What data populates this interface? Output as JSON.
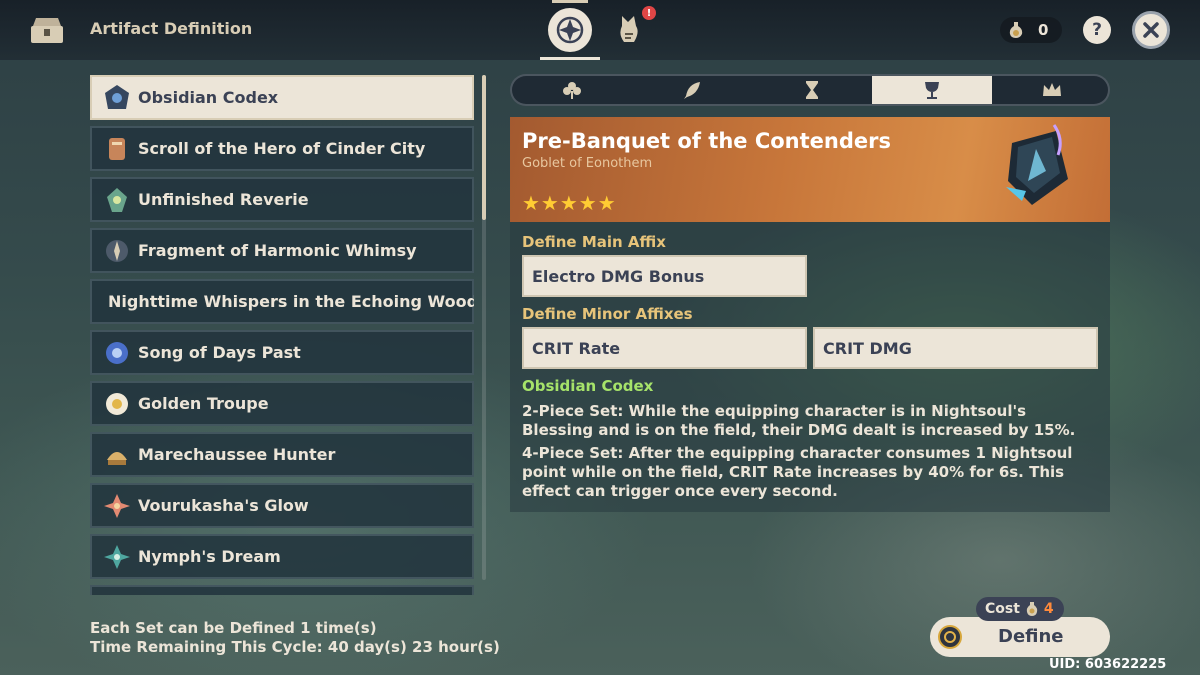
{
  "header": {
    "title": "Artifact Definition",
    "notification_badge": "!",
    "currency_count": "0",
    "help_label": "?"
  },
  "sets": [
    {
      "label": "Obsidian Codex",
      "selected": true,
      "icon": "obsidian-codex-icon"
    },
    {
      "label": "Scroll of the Hero of Cinder City",
      "icon": "scroll-hero-icon"
    },
    {
      "label": "Unfinished Reverie",
      "icon": "unfinished-reverie-icon"
    },
    {
      "label": "Fragment of Harmonic Whimsy",
      "icon": "harmonic-whimsy-icon"
    },
    {
      "label": "Nighttime Whispers in the Echoing Woods",
      "icon": "nighttime-whispers-icon"
    },
    {
      "label": "Song of Days Past",
      "icon": "song-days-past-icon"
    },
    {
      "label": "Golden Troupe",
      "icon": "golden-troupe-icon"
    },
    {
      "label": "Marechaussee Hunter",
      "icon": "marechaussee-hunter-icon"
    },
    {
      "label": "Vourukasha's Glow",
      "icon": "vourukasha-glow-icon"
    },
    {
      "label": "Nymph's Dream",
      "icon": "nymphs-dream-icon"
    }
  ],
  "footer": {
    "line1": "Each Set can be Defined 1 time(s)",
    "line2": "Time Remaining This Cycle: 40 day(s) 23 hour(s)"
  },
  "slot_tabs": [
    {
      "icon": "flower-icon"
    },
    {
      "icon": "feather-icon"
    },
    {
      "icon": "hourglass-icon"
    },
    {
      "icon": "goblet-icon",
      "active": true
    },
    {
      "icon": "crown-icon"
    }
  ],
  "artifact": {
    "name": "Pre-Banquet of the Contenders",
    "type": "Goblet of Eonothem",
    "stars": "★★★★★",
    "rarity": 5
  },
  "main_affix": {
    "label": "Define Main Affix",
    "value": "Electro DMG Bonus"
  },
  "minor_affixes": {
    "label": "Define Minor Affixes",
    "values": [
      "CRIT Rate",
      "CRIT DMG"
    ]
  },
  "set_bonus": {
    "name": "Obsidian Codex",
    "two_piece": "2-Piece Set: While the equipping character is in Nightsoul's Blessing and is on the field, their DMG dealt is increased by 15%.",
    "four_piece": "4-Piece Set: After the equipping character consumes 1 Nightsoul point while on the field, CRIT Rate increases by 40% for 6s. This effect can trigger once every second."
  },
  "define": {
    "cost_label": "Cost",
    "cost_value": "4",
    "button_label": "Define"
  },
  "uid": "UID: 603622225",
  "colors": {
    "cream": "#ece5d8",
    "dark_text": "#3b4255",
    "gold_label": "#e7c47a",
    "set_green": "#a6e36a",
    "star": "#ffcc33",
    "cost_orange": "#ff8a3c"
  }
}
